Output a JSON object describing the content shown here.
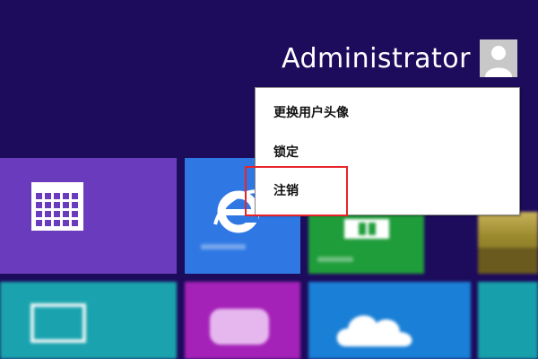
{
  "user": {
    "name": "Administrator",
    "avatar_icon": "user-silhouette-icon"
  },
  "context_menu": {
    "items": [
      {
        "label": "更换用户头像"
      },
      {
        "label": "锁定"
      },
      {
        "label": "注销"
      }
    ],
    "highlighted_item": "注销",
    "highlight_color": "#e8242a"
  },
  "tiles": [
    {
      "name": "calendar",
      "color": "#6b3bbd",
      "icon": "calendar-icon"
    },
    {
      "name": "internet-explorer",
      "color": "#2f78e4",
      "icon": "ie-logo-icon"
    },
    {
      "name": "store",
      "color": "#1f9d3a",
      "icon": "store-icon"
    },
    {
      "name": "photo",
      "color": "#c7b25a",
      "icon": "landscape-icon"
    },
    {
      "name": "photos",
      "color": "#1aa3ae",
      "icon": "picture-icon"
    },
    {
      "name": "games",
      "color": "#a522b8",
      "icon": "gamepad-icon"
    },
    {
      "name": "skydrive",
      "color": "#1a7fd6",
      "icon": "cloud-icon"
    },
    {
      "name": "extra",
      "color": "#17a0ab",
      "icon": ""
    }
  ],
  "colors": {
    "background": "#1d0b5c",
    "menu_background": "#ffffff"
  }
}
